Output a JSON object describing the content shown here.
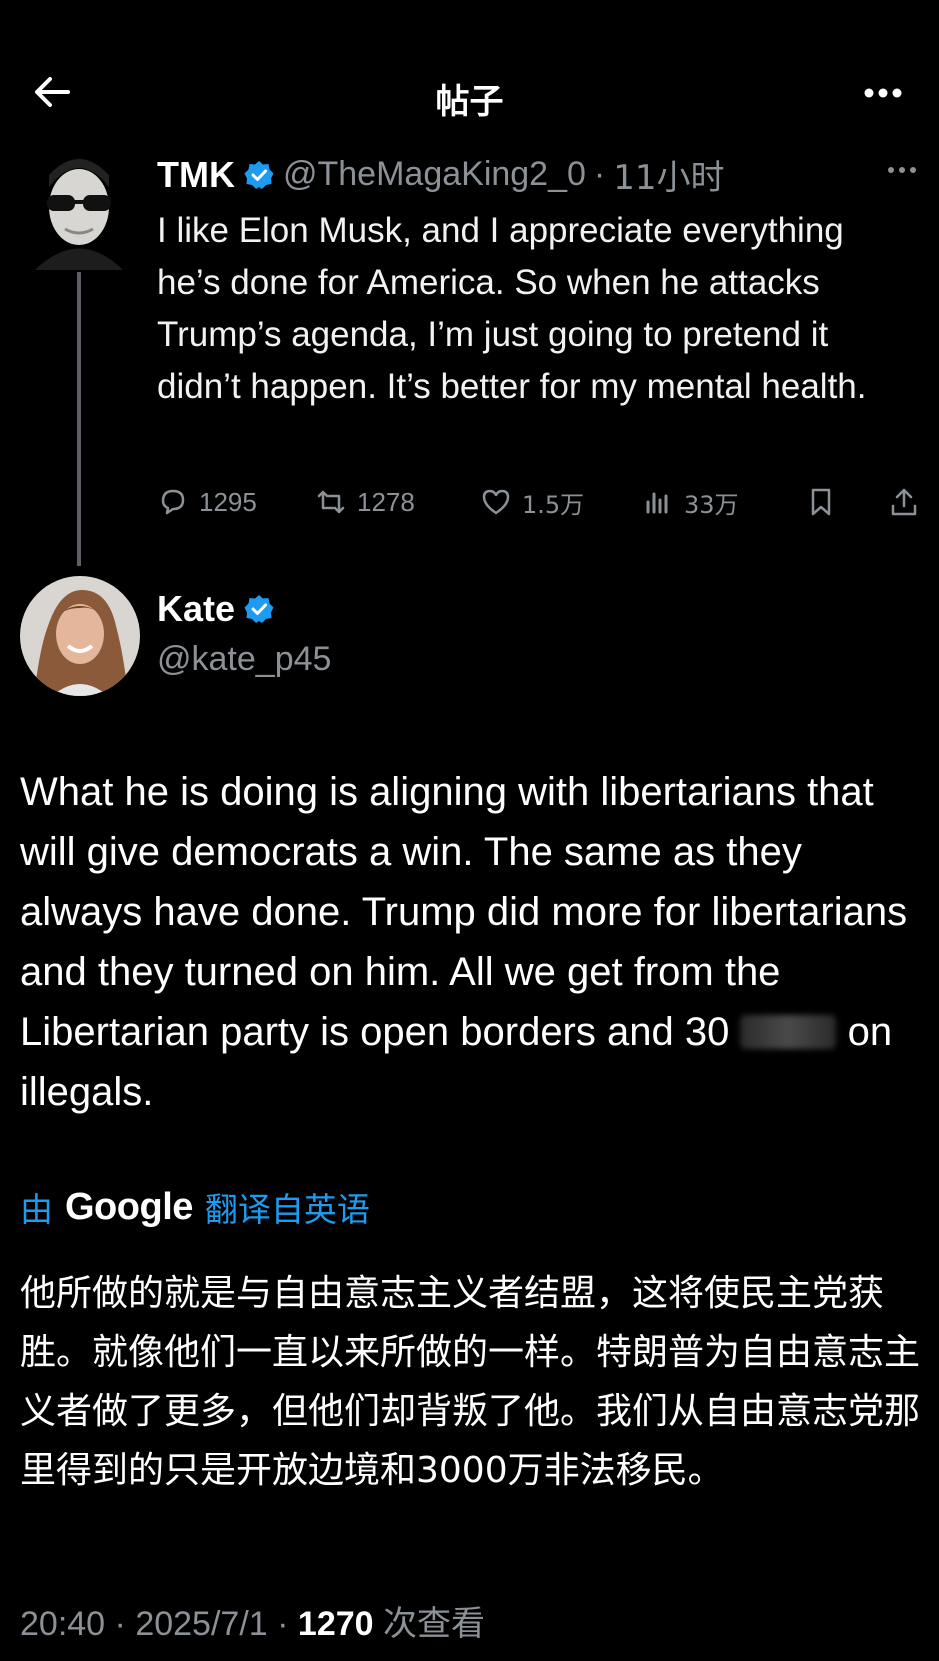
{
  "header": {
    "title": "帖子"
  },
  "parent_tweet": {
    "display_name": "TMK",
    "handle": "@TheMagaKing2_0",
    "separator": "·",
    "time": "11小时",
    "text": "I like Elon Musk, and I appreciate everything he’s done for America. So when he attacks Trump’s agenda, I’m just going to pretend it didn’t happen. It’s better for my mental health.",
    "replies": "1295",
    "reposts": "1278",
    "likes": "1.5万",
    "views": "33万"
  },
  "main_tweet": {
    "display_name": "Kate",
    "handle": "@kate_p45",
    "text_part1": "What he is doing is aligning with libertarians that will give democrats a win. The same as they always have done. Trump did more for libertarians and they turned on him. All we get from the Libertarian party is open borders and 30",
    "text_part2": "on illegals.",
    "translate_prefix": "由",
    "translate_brand": "Google",
    "translate_suffix": "翻译自英语",
    "translation": "他所做的就是与自由意志主义者结盟，这将使民主党获胜。就像他们一直以来所做的一样。特朗普为自由意志主义者做了更多，但他们却背叛了他。我们从自由意志党那里得到的只是开放边境和3000万非法移民。",
    "time": "20:40",
    "dot1": "·",
    "date": "2025/7/1",
    "dot2": "·",
    "view_count": "1270",
    "view_label": "次查看"
  },
  "colors": {
    "background": "#000000",
    "accent": "#1d9bf0",
    "muted": "#8b9196",
    "verified": "#1d9bf0"
  }
}
